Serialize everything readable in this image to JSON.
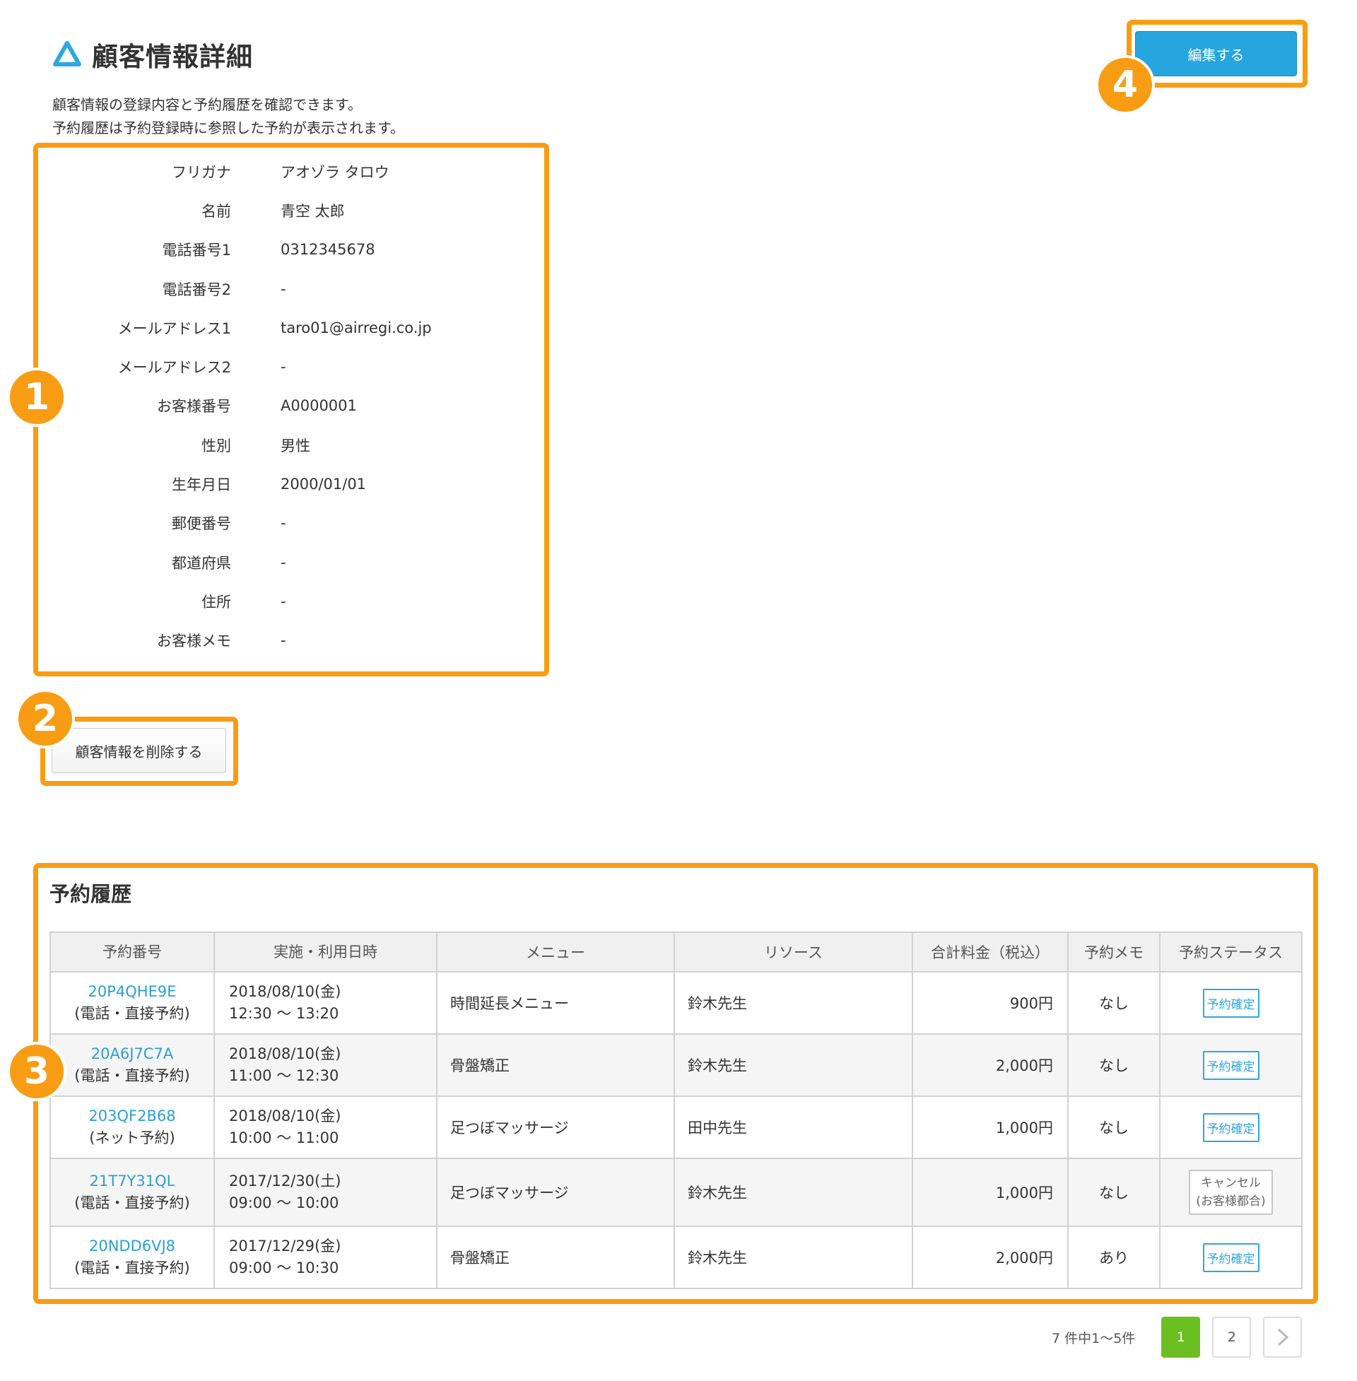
{
  "header": {
    "title": "顧客情報詳細"
  },
  "description": {
    "line1": "顧客情報の登録内容と予約履歴を確認できます。",
    "line2": "予約履歴は予約登録時に参照した予約が表示されます。"
  },
  "edit_button": "編集する",
  "delete_button": "顧客情報を削除する",
  "badges": [
    "1",
    "2",
    "3",
    "4"
  ],
  "customer": [
    {
      "label": "フリガナ",
      "value": "アオゾラ タロウ"
    },
    {
      "label": "名前",
      "value": "青空 太郎"
    },
    {
      "label": "電話番号1",
      "value": "0312345678"
    },
    {
      "label": "電話番号2",
      "value": "-"
    },
    {
      "label": "メールアドレス1",
      "value": "taro01@airregi.co.jp"
    },
    {
      "label": "メールアドレス2",
      "value": "-"
    },
    {
      "label": "お客様番号",
      "value": "A0000001"
    },
    {
      "label": "性別",
      "value": "男性"
    },
    {
      "label": "生年月日",
      "value": "2000/01/01"
    },
    {
      "label": "郵便番号",
      "value": "-"
    },
    {
      "label": "都道府県",
      "value": "-"
    },
    {
      "label": "住所",
      "value": "-"
    },
    {
      "label": "お客様メモ",
      "value": "-"
    }
  ],
  "history": {
    "title": "予約履歴",
    "columns": [
      "予約番号",
      "実施・利用日時",
      "メニュー",
      "リソース",
      "合計料金（税込）",
      "予約メモ",
      "予約ステータス"
    ],
    "rows": [
      {
        "id": "20P4QHE9E",
        "channel": "(電話・直接予約)",
        "date": "2018/08/10(金)",
        "time": "12:30 〜 13:20",
        "menu": "時間延長メニュー",
        "resource": "鈴木先生",
        "price": "900円",
        "memo": "なし",
        "status": "予約確定"
      },
      {
        "id": "20A6J7C7A",
        "channel": "(電話・直接予約)",
        "date": "2018/08/10(金)",
        "time": "11:00 〜 12:30",
        "menu": "骨盤矯正",
        "resource": "鈴木先生",
        "price": "2,000円",
        "memo": "なし",
        "status": "予約確定"
      },
      {
        "id": "203QF2B68",
        "channel": "(ネット予約)",
        "date": "2018/08/10(金)",
        "time": "10:00 〜 11:00",
        "menu": "足つぼマッサージ",
        "resource": "田中先生",
        "price": "1,000円",
        "memo": "なし",
        "status": "予約確定"
      },
      {
        "id": "21T7Y31QL",
        "channel": "(電話・直接予約)",
        "date": "2017/12/30(土)",
        "time": "09:00 〜 10:00",
        "menu": "足つぼマッサージ",
        "resource": "鈴木先生",
        "price": "1,000円",
        "memo": "なし",
        "status_line1": "キャンセル",
        "status_line2": "(お客様都合)"
      },
      {
        "id": "20NDD6VJ8",
        "channel": "(電話・直接予約)",
        "date": "2017/12/29(金)",
        "time": "09:00 〜 10:30",
        "menu": "骨盤矯正",
        "resource": "鈴木先生",
        "price": "2,000円",
        "memo": "あり",
        "status": "予約確定"
      }
    ]
  },
  "pagination": {
    "summary": "7 件中1〜5件",
    "pages": [
      "1",
      "2"
    ],
    "current": "1"
  },
  "colors": {
    "highlight": "#f89d13",
    "primary": "#26a6de",
    "link": "#2a9fd6",
    "active_page": "#6cbf20"
  },
  "icons": {
    "logo": "triangle-logo-icon",
    "next": "chevron-right-icon"
  }
}
